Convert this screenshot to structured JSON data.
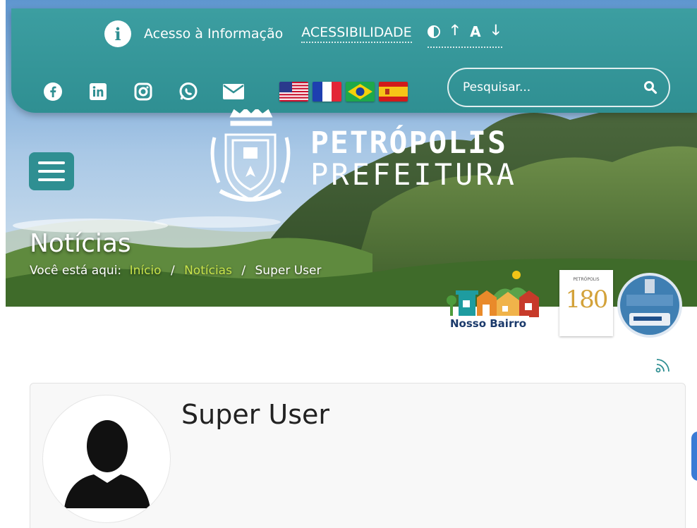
{
  "topbar": {
    "access_info_label": "Acesso à Informação",
    "accessibility_label": "ACESSIBILIDADE",
    "font_increase": "A",
    "search_placeholder": "Pesquisar..."
  },
  "social": [
    "facebook-icon",
    "linkedin-icon",
    "instagram-icon",
    "whatsapp-icon",
    "email-icon"
  ],
  "flags": [
    "flag-us",
    "flag-fr",
    "flag-br",
    "flag-es"
  ],
  "logo": {
    "line1": "PETRÓPOLIS",
    "line2": "PREFEITURA"
  },
  "page": {
    "title": "Notícias",
    "breadcrumb_prefix": "Você está aqui:",
    "breadcrumb": [
      "Início",
      "Notícias",
      "Super User"
    ]
  },
  "badges": {
    "nosso_bairro": "Nosso Bairro",
    "anniversary_number": "180",
    "anniversary_city": "PETRÓPOLIS"
  },
  "author": {
    "name": "Super User"
  },
  "colors": {
    "teal": "#2f8f92",
    "breadcrumb_link": "#c8e34a"
  }
}
